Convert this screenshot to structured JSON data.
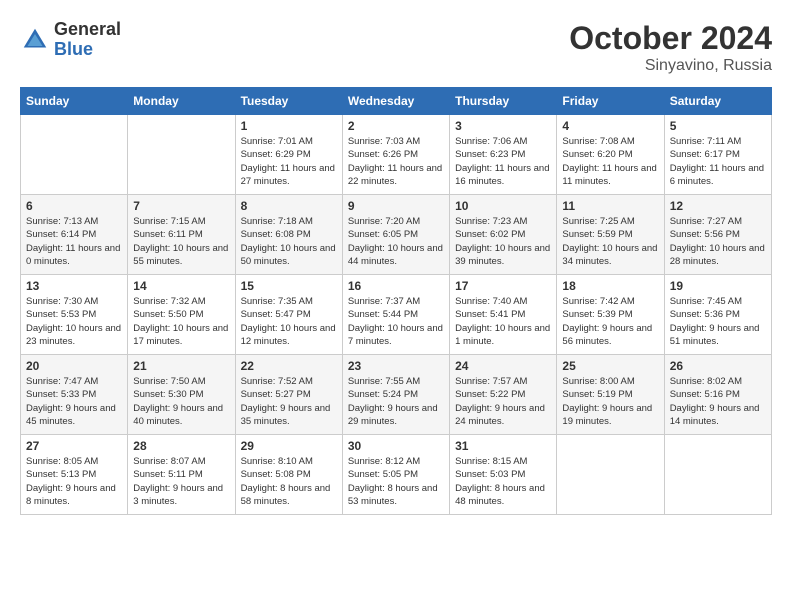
{
  "logo": {
    "general": "General",
    "blue": "Blue"
  },
  "header": {
    "month": "October 2024",
    "location": "Sinyavino, Russia"
  },
  "weekdays": [
    "Sunday",
    "Monday",
    "Tuesday",
    "Wednesday",
    "Thursday",
    "Friday",
    "Saturday"
  ],
  "weeks": [
    [
      {
        "day": "",
        "detail": ""
      },
      {
        "day": "",
        "detail": ""
      },
      {
        "day": "1",
        "detail": "Sunrise: 7:01 AM\nSunset: 6:29 PM\nDaylight: 11 hours and 27 minutes."
      },
      {
        "day": "2",
        "detail": "Sunrise: 7:03 AM\nSunset: 6:26 PM\nDaylight: 11 hours and 22 minutes."
      },
      {
        "day": "3",
        "detail": "Sunrise: 7:06 AM\nSunset: 6:23 PM\nDaylight: 11 hours and 16 minutes."
      },
      {
        "day": "4",
        "detail": "Sunrise: 7:08 AM\nSunset: 6:20 PM\nDaylight: 11 hours and 11 minutes."
      },
      {
        "day": "5",
        "detail": "Sunrise: 7:11 AM\nSunset: 6:17 PM\nDaylight: 11 hours and 6 minutes."
      }
    ],
    [
      {
        "day": "6",
        "detail": "Sunrise: 7:13 AM\nSunset: 6:14 PM\nDaylight: 11 hours and 0 minutes."
      },
      {
        "day": "7",
        "detail": "Sunrise: 7:15 AM\nSunset: 6:11 PM\nDaylight: 10 hours and 55 minutes."
      },
      {
        "day": "8",
        "detail": "Sunrise: 7:18 AM\nSunset: 6:08 PM\nDaylight: 10 hours and 50 minutes."
      },
      {
        "day": "9",
        "detail": "Sunrise: 7:20 AM\nSunset: 6:05 PM\nDaylight: 10 hours and 44 minutes."
      },
      {
        "day": "10",
        "detail": "Sunrise: 7:23 AM\nSunset: 6:02 PM\nDaylight: 10 hours and 39 minutes."
      },
      {
        "day": "11",
        "detail": "Sunrise: 7:25 AM\nSunset: 5:59 PM\nDaylight: 10 hours and 34 minutes."
      },
      {
        "day": "12",
        "detail": "Sunrise: 7:27 AM\nSunset: 5:56 PM\nDaylight: 10 hours and 28 minutes."
      }
    ],
    [
      {
        "day": "13",
        "detail": "Sunrise: 7:30 AM\nSunset: 5:53 PM\nDaylight: 10 hours and 23 minutes."
      },
      {
        "day": "14",
        "detail": "Sunrise: 7:32 AM\nSunset: 5:50 PM\nDaylight: 10 hours and 17 minutes."
      },
      {
        "day": "15",
        "detail": "Sunrise: 7:35 AM\nSunset: 5:47 PM\nDaylight: 10 hours and 12 minutes."
      },
      {
        "day": "16",
        "detail": "Sunrise: 7:37 AM\nSunset: 5:44 PM\nDaylight: 10 hours and 7 minutes."
      },
      {
        "day": "17",
        "detail": "Sunrise: 7:40 AM\nSunset: 5:41 PM\nDaylight: 10 hours and 1 minute."
      },
      {
        "day": "18",
        "detail": "Sunrise: 7:42 AM\nSunset: 5:39 PM\nDaylight: 9 hours and 56 minutes."
      },
      {
        "day": "19",
        "detail": "Sunrise: 7:45 AM\nSunset: 5:36 PM\nDaylight: 9 hours and 51 minutes."
      }
    ],
    [
      {
        "day": "20",
        "detail": "Sunrise: 7:47 AM\nSunset: 5:33 PM\nDaylight: 9 hours and 45 minutes."
      },
      {
        "day": "21",
        "detail": "Sunrise: 7:50 AM\nSunset: 5:30 PM\nDaylight: 9 hours and 40 minutes."
      },
      {
        "day": "22",
        "detail": "Sunrise: 7:52 AM\nSunset: 5:27 PM\nDaylight: 9 hours and 35 minutes."
      },
      {
        "day": "23",
        "detail": "Sunrise: 7:55 AM\nSunset: 5:24 PM\nDaylight: 9 hours and 29 minutes."
      },
      {
        "day": "24",
        "detail": "Sunrise: 7:57 AM\nSunset: 5:22 PM\nDaylight: 9 hours and 24 minutes."
      },
      {
        "day": "25",
        "detail": "Sunrise: 8:00 AM\nSunset: 5:19 PM\nDaylight: 9 hours and 19 minutes."
      },
      {
        "day": "26",
        "detail": "Sunrise: 8:02 AM\nSunset: 5:16 PM\nDaylight: 9 hours and 14 minutes."
      }
    ],
    [
      {
        "day": "27",
        "detail": "Sunrise: 8:05 AM\nSunset: 5:13 PM\nDaylight: 9 hours and 8 minutes."
      },
      {
        "day": "28",
        "detail": "Sunrise: 8:07 AM\nSunset: 5:11 PM\nDaylight: 9 hours and 3 minutes."
      },
      {
        "day": "29",
        "detail": "Sunrise: 8:10 AM\nSunset: 5:08 PM\nDaylight: 8 hours and 58 minutes."
      },
      {
        "day": "30",
        "detail": "Sunrise: 8:12 AM\nSunset: 5:05 PM\nDaylight: 8 hours and 53 minutes."
      },
      {
        "day": "31",
        "detail": "Sunrise: 8:15 AM\nSunset: 5:03 PM\nDaylight: 8 hours and 48 minutes."
      },
      {
        "day": "",
        "detail": ""
      },
      {
        "day": "",
        "detail": ""
      }
    ]
  ]
}
